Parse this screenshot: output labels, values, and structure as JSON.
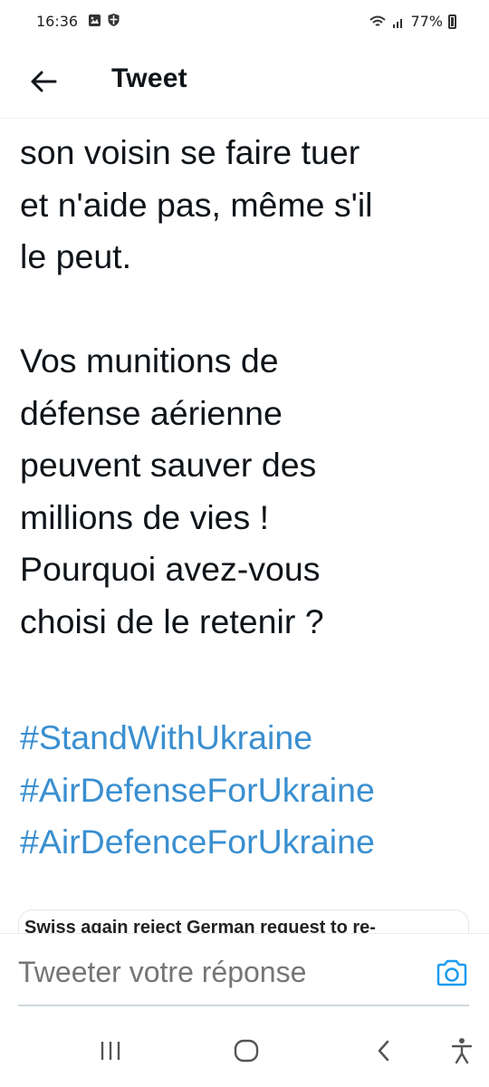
{
  "status_bar": {
    "time": "16:36",
    "battery_text": "77%",
    "icons_left": [
      "gallery-icon",
      "shield-icon"
    ],
    "icons_right": [
      "wifi-icon",
      "signal-icon",
      "battery-icon"
    ]
  },
  "header": {
    "title": "Tweet",
    "back_icon": "back-arrow-icon"
  },
  "tweet": {
    "body": "son voisin se faire tuer\net n'aide pas, même s'il\nle peut.\n\nVos munitions de\ndéfense aérienne\npeuvent sauver des\nmillions de vies !\nPourquoi avez-vous\nchoisi de le retenir ?",
    "hashtags": [
      "#StandWithUkraine",
      "#AirDefenseForUkraine",
      "#AirDefenceForUkraine"
    ]
  },
  "link_card": {
    "title": "Swiss again reject German request to re-"
  },
  "reply": {
    "placeholder": "Tweeter votre réponse",
    "camera_icon": "camera-icon"
  },
  "nav_bar": {
    "items": [
      "recent-apps-icon",
      "home-icon",
      "back-icon",
      "accessibility-icon"
    ]
  },
  "colors": {
    "hashtag": "#3a8fd0",
    "camera": "#1d9bf0",
    "text": "#0f1419",
    "placeholder": "#536471"
  }
}
